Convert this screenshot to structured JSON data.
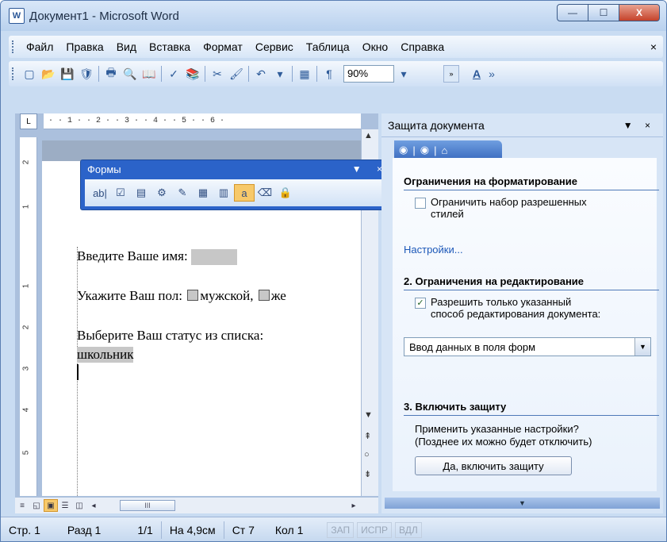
{
  "window": {
    "title": "Документ1 - Microsoft Word",
    "app_icon_text": "W",
    "minimize_glyph": "—",
    "maximize_glyph": "☐",
    "close_glyph": "X"
  },
  "menubar": {
    "items": [
      "Файл",
      "Правка",
      "Вид",
      "Вставка",
      "Формат",
      "Сервис",
      "Таблица",
      "Окно",
      "Справка"
    ],
    "close_glyph": "×"
  },
  "toolbar": {
    "zoom_value": "90%",
    "icons": [
      "new-doc",
      "open",
      "save",
      "permission",
      "print",
      "print-preview",
      "research",
      "spelling",
      "research-book",
      "cut",
      "format-painter",
      "undo",
      "table",
      "show-formatting"
    ]
  },
  "ruler": {
    "corner_glyph": "L",
    "marks": "·  ·  1  ·  ·  2  ·  ·  3  ·  ·  4  ·  ·  5  ·  ·  6  ·",
    "vertical_marks": [
      "2",
      "1",
      "1",
      "2",
      "3",
      "4",
      "5"
    ]
  },
  "forms_toolbar": {
    "title": "Формы",
    "controls": "▼ ×",
    "icons": [
      "ab|",
      "☑",
      "▤",
      "⚙",
      "✎",
      "▦",
      "▥",
      "a",
      "⌫",
      "🔒"
    ]
  },
  "document": {
    "line1_label": "Введите Ваше имя:",
    "line2_label": "Укажите Ваш пол:",
    "line2_opt1": "мужской,",
    "line2_opt2": "же",
    "line3_label": "Выберите Ваш статус из списка:",
    "line3_value": "школьник"
  },
  "viewbar": {
    "scroll_thumb": "III"
  },
  "taskpane": {
    "title": "Защита документа",
    "controls": "▼ ×",
    "section1_title": "Ограничения на форматирование",
    "section1_check_line1": "Ограничить набор разрешенных",
    "section1_check_line2": "стилей",
    "settings_link": "Настройки...",
    "section2_title": "2. Ограничения на редактирование",
    "section2_check_line1": "Разрешить только указанный",
    "section2_check_line2": "способ редактирования документа:",
    "edit_mode_select": "Ввод данных в поля форм",
    "section3_title": "3. Включить защиту",
    "section3_text_line1": "Применить указанные настройки?",
    "section3_text_line2": "(Позднее их можно будет отключить)",
    "enforce_button": "Да, включить защиту"
  },
  "statusbar": {
    "page": "Стр. 1",
    "section": "Разд 1",
    "pages": "1/1",
    "position": "На 4,9см",
    "line": "Ст 7",
    "column": "Кол 1",
    "rec": "ЗАП",
    "trk": "ИСПР",
    "ext": "ВДЛ"
  }
}
